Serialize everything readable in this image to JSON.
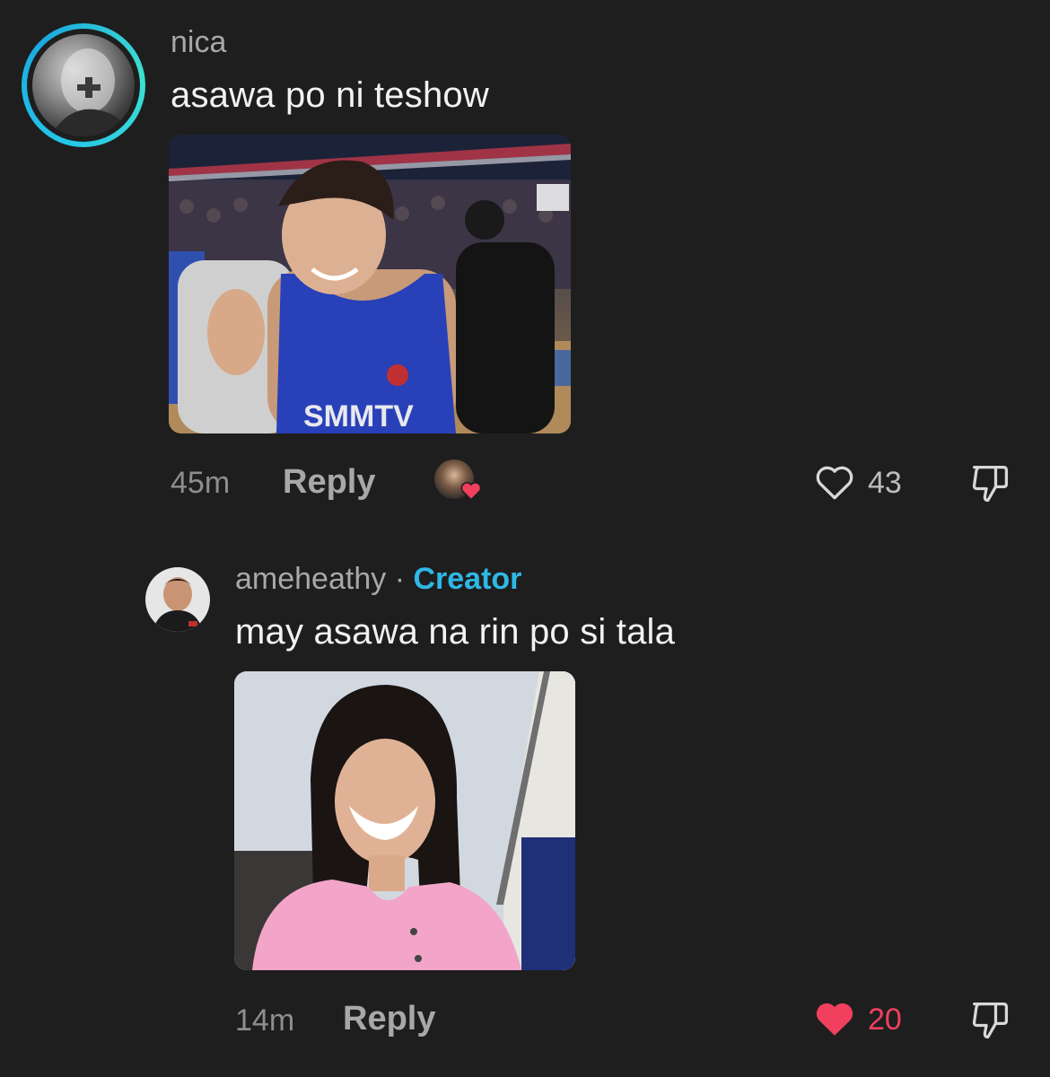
{
  "comments": [
    {
      "username": "nica",
      "text": "asawa po ni teshow",
      "image_text": "SMMTV",
      "time": "45m",
      "reply_label": "Reply",
      "like_count": "43",
      "liked": false
    },
    {
      "username": "ameheathy",
      "separator": "·",
      "badge": "Creator",
      "text": "may asawa na rin po si tala",
      "time": "14m",
      "reply_label": "Reply",
      "like_count": "20",
      "liked": true
    }
  ],
  "colors": {
    "background": "#1e1e1e",
    "creator_accent": "#2fb8e6",
    "liked_heart": "#f0405e",
    "avatar_ring": "#23c6e8"
  },
  "icons": {
    "like": "heart-outline-icon",
    "liked": "heart-filled-icon",
    "dislike": "thumbs-down-icon",
    "creator_liked": "creator-heart-badge-icon"
  }
}
